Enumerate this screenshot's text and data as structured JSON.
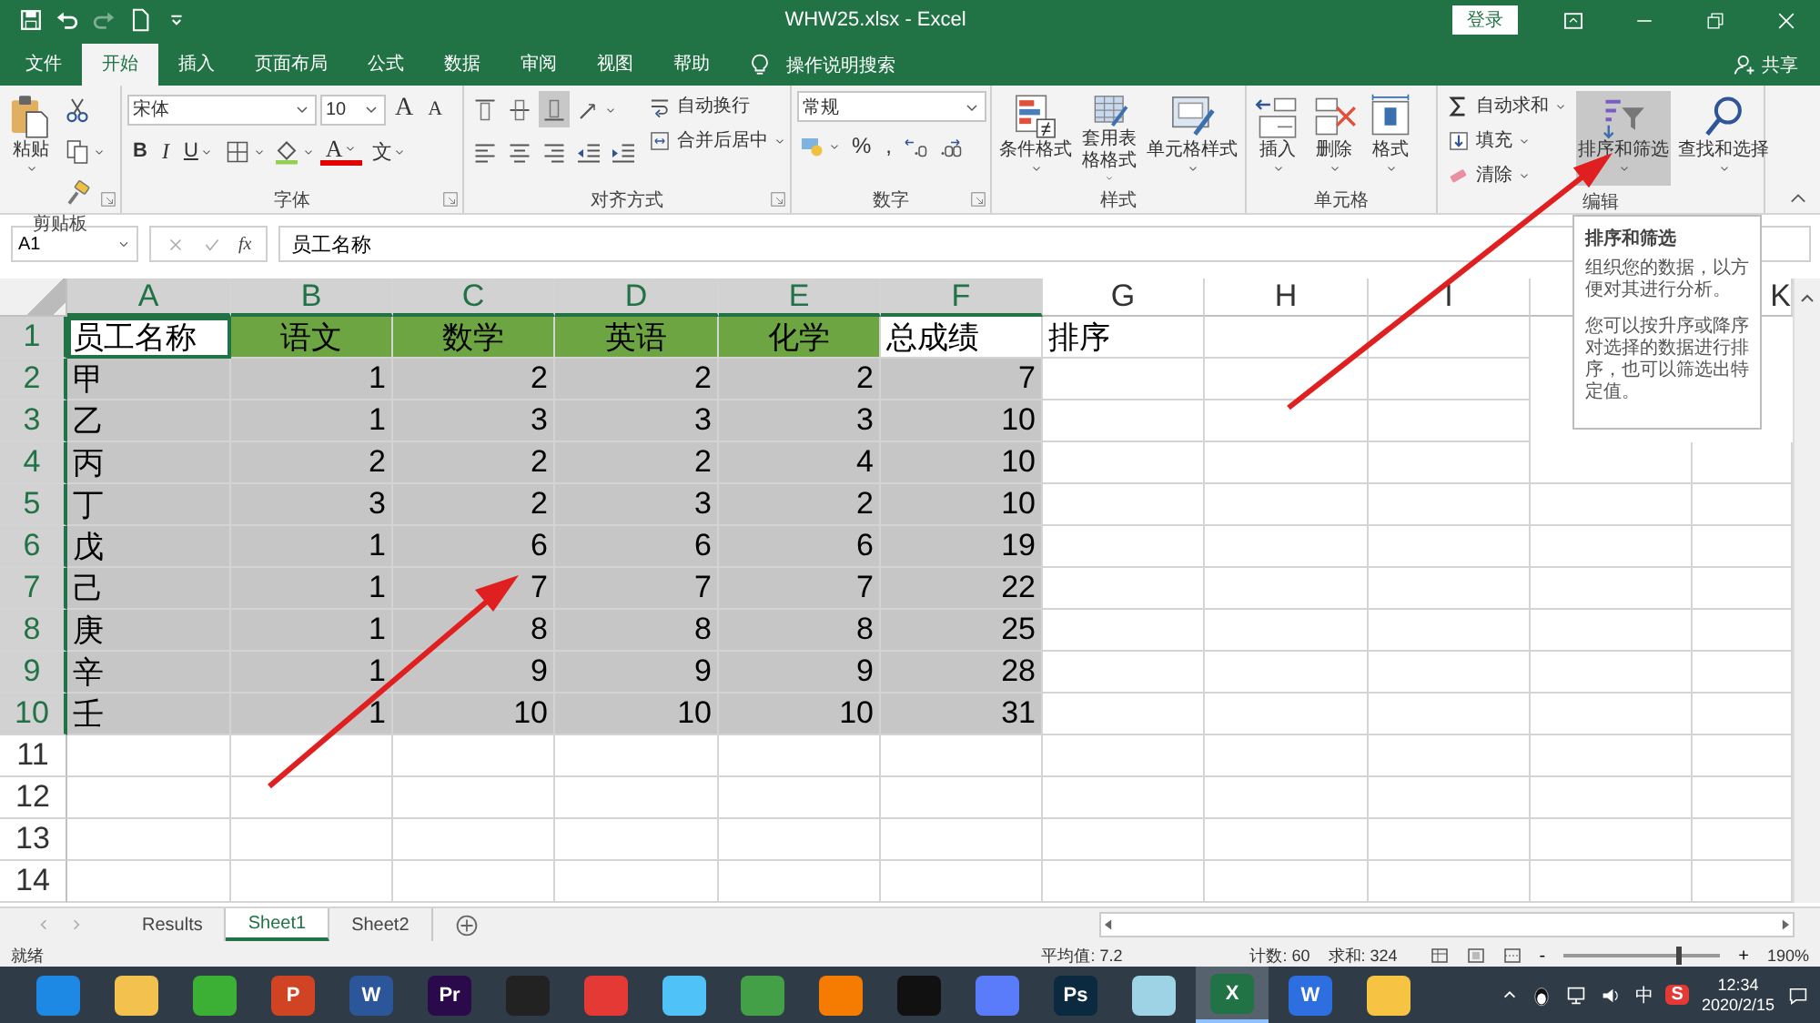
{
  "title_bar": {
    "title": "WHW25.xlsx  -  Excel",
    "login": "登录"
  },
  "tabs": [
    {
      "label": "文件",
      "selected": false
    },
    {
      "label": "开始",
      "selected": true
    },
    {
      "label": "插入",
      "selected": false
    },
    {
      "label": "页面布局",
      "selected": false
    },
    {
      "label": "公式",
      "selected": false
    },
    {
      "label": "数据",
      "selected": false
    },
    {
      "label": "审阅",
      "selected": false
    },
    {
      "label": "视图",
      "selected": false
    },
    {
      "label": "帮助",
      "selected": false
    }
  ],
  "tell_me": "操作说明搜索",
  "share": "共享",
  "ribbon": [
    {
      "kind": "clipboard",
      "label": "剪贴板",
      "items": [
        {
          "kind": "paste",
          "label": "粘贴"
        },
        {
          "kind": "cut"
        },
        {
          "kind": "copy"
        },
        {
          "kind": "painter"
        }
      ]
    },
    {
      "kind": "font",
      "label": "字体",
      "items": [
        {
          "kind": "font-name",
          "value": "宋体"
        },
        {
          "kind": "font-size",
          "value": "10"
        },
        {
          "kind": "grow",
          "label": "A"
        },
        {
          "kind": "shrink",
          "label": "A"
        },
        {
          "kind": "bold",
          "label": "B"
        },
        {
          "kind": "italic",
          "label": "I"
        },
        {
          "kind": "underline",
          "label": "U"
        },
        {
          "kind": "border"
        },
        {
          "kind": "fill-color"
        },
        {
          "kind": "font-color",
          "label": "A"
        },
        {
          "kind": "phonetic",
          "label": "文"
        }
      ]
    },
    {
      "kind": "alignment",
      "label": "对齐方式",
      "items": [
        {
          "kind": "align-top",
          "selected": false
        },
        {
          "kind": "align-middle",
          "selected": false
        },
        {
          "kind": "align-bottom",
          "selected": true
        },
        {
          "kind": "orientation"
        },
        {
          "kind": "align-left"
        },
        {
          "kind": "align-center"
        },
        {
          "kind": "align-right"
        },
        {
          "kind": "indent-less"
        },
        {
          "kind": "indent-more"
        },
        {
          "kind": "wrap",
          "label": "自动换行"
        },
        {
          "kind": "merge",
          "label": "合并后居中"
        }
      ]
    },
    {
      "kind": "number",
      "label": "数字",
      "items": [
        {
          "kind": "number-format",
          "value": "常规"
        },
        {
          "kind": "currency"
        },
        {
          "kind": "percent",
          "label": "%"
        },
        {
          "kind": "comma",
          "label": ","
        },
        {
          "kind": "inc-decimal"
        },
        {
          "kind": "dec-decimal"
        }
      ]
    },
    {
      "kind": "styles",
      "label": "样式",
      "items": [
        {
          "kind": "cond-format",
          "label": "条件格式"
        },
        {
          "kind": "table-format",
          "label": "套用表格格式"
        },
        {
          "kind": "cell-style",
          "label": "单元格样式"
        }
      ]
    },
    {
      "kind": "cells",
      "label": "单元格",
      "items": [
        {
          "kind": "insert-cells",
          "label": "插入"
        },
        {
          "kind": "delete-cells",
          "label": "删除"
        },
        {
          "kind": "format-cells",
          "label": "格式"
        }
      ]
    },
    {
      "kind": "editing",
      "label": "编辑",
      "items": [
        {
          "kind": "sum",
          "label": "自动求和"
        },
        {
          "kind": "fill-down",
          "label": "填充"
        },
        {
          "kind": "eraser",
          "label": "清除"
        },
        {
          "kind": "sort-filter",
          "label": "排序和筛选",
          "selected": true
        },
        {
          "kind": "find",
          "label": "查找和选择",
          "selected": false
        }
      ]
    }
  ],
  "formula_bar": {
    "name_box": "A1",
    "function_label": "fx",
    "value": "员工名称"
  },
  "columns": [
    {
      "label": "A",
      "selected": true
    },
    {
      "label": "B",
      "selected": true
    },
    {
      "label": "C",
      "selected": true
    },
    {
      "label": "D",
      "selected": true
    },
    {
      "label": "E",
      "selected": true
    },
    {
      "label": "F",
      "selected": true
    },
    {
      "label": "G",
      "selected": false
    },
    {
      "label": "H",
      "selected": false
    },
    {
      "label": "I",
      "selected": false
    },
    {
      "selected": false
    },
    {
      "label": "K",
      "selected": false
    }
  ],
  "rows": [
    {
      "number": "1",
      "selected": true,
      "cells": [
        {
          "text": "员工名称",
          "kind": "active",
          "numeric": false
        },
        {
          "text": "语文",
          "kind": "green",
          "numeric": false
        },
        {
          "text": "数学",
          "kind": "green",
          "numeric": false
        },
        {
          "text": "英语",
          "kind": "green",
          "numeric": false
        },
        {
          "text": "化学",
          "kind": "green",
          "numeric": false
        },
        {
          "text": "总成绩",
          "kind": "plain",
          "numeric": false
        },
        {
          "text": "排序",
          "kind": "plain",
          "numeric": false
        }
      ]
    },
    {
      "number": "2",
      "selected": true,
      "cells": [
        {
          "text": "甲",
          "kind": "selected",
          "numeric": false
        },
        {
          "text": "1",
          "kind": "selected",
          "numeric": true
        },
        {
          "text": "2",
          "kind": "selected",
          "numeric": true
        },
        {
          "text": "2",
          "kind": "selected",
          "numeric": true
        },
        {
          "text": "2",
          "kind": "selected",
          "numeric": true
        },
        {
          "text": "7",
          "kind": "selected",
          "numeric": true
        }
      ]
    },
    {
      "number": "3",
      "selected": true,
      "cells": [
        {
          "text": "乙",
          "kind": "selected",
          "numeric": false
        },
        {
          "text": "1",
          "kind": "selected",
          "numeric": true
        },
        {
          "text": "3",
          "kind": "selected",
          "numeric": true
        },
        {
          "text": "3",
          "kind": "selected",
          "numeric": true
        },
        {
          "text": "3",
          "kind": "selected",
          "numeric": true
        },
        {
          "text": "10",
          "kind": "selected",
          "numeric": true
        }
      ]
    },
    {
      "number": "4",
      "selected": true,
      "cells": [
        {
          "text": "丙",
          "kind": "selected",
          "numeric": false
        },
        {
          "text": "2",
          "kind": "selected",
          "numeric": true
        },
        {
          "text": "2",
          "kind": "selected",
          "numeric": true
        },
        {
          "text": "2",
          "kind": "selected",
          "numeric": true
        },
        {
          "text": "4",
          "kind": "selected",
          "numeric": true
        },
        {
          "text": "10",
          "kind": "selected",
          "numeric": true
        }
      ]
    },
    {
      "number": "5",
      "selected": true,
      "cells": [
        {
          "text": "丁",
          "kind": "selected",
          "numeric": false
        },
        {
          "text": "3",
          "kind": "selected",
          "numeric": true
        },
        {
          "text": "2",
          "kind": "selected",
          "numeric": true
        },
        {
          "text": "3",
          "kind": "selected",
          "numeric": true
        },
        {
          "text": "2",
          "kind": "selected",
          "numeric": true
        },
        {
          "text": "10",
          "kind": "selected",
          "numeric": true
        }
      ]
    },
    {
      "number": "6",
      "selected": true,
      "cells": [
        {
          "text": "戊",
          "kind": "selected",
          "numeric": false
        },
        {
          "text": "1",
          "kind": "selected",
          "numeric": true
        },
        {
          "text": "6",
          "kind": "selected",
          "numeric": true
        },
        {
          "text": "6",
          "kind": "selected",
          "numeric": true
        },
        {
          "text": "6",
          "kind": "selected",
          "numeric": true
        },
        {
          "text": "19",
          "kind": "selected",
          "numeric": true
        }
      ]
    },
    {
      "number": "7",
      "selected": true,
      "cells": [
        {
          "text": "己",
          "kind": "selected",
          "numeric": false
        },
        {
          "text": "1",
          "kind": "selected",
          "numeric": true
        },
        {
          "text": "7",
          "kind": "selected",
          "numeric": true
        },
        {
          "text": "7",
          "kind": "selected",
          "numeric": true
        },
        {
          "text": "7",
          "kind": "selected",
          "numeric": true
        },
        {
          "text": "22",
          "kind": "selected",
          "numeric": true
        }
      ]
    },
    {
      "number": "8",
      "selected": true,
      "cells": [
        {
          "text": "庚",
          "kind": "selected",
          "numeric": false
        },
        {
          "text": "1",
          "kind": "selected",
          "numeric": true
        },
        {
          "text": "8",
          "kind": "selected",
          "numeric": true
        },
        {
          "text": "8",
          "kind": "selected",
          "numeric": true
        },
        {
          "text": "8",
          "kind": "selected",
          "numeric": true
        },
        {
          "text": "25",
          "kind": "selected",
          "numeric": true
        }
      ]
    },
    {
      "number": "9",
      "selected": true,
      "cells": [
        {
          "text": "辛",
          "kind": "selected",
          "numeric": false
        },
        {
          "text": "1",
          "kind": "selected",
          "numeric": true
        },
        {
          "text": "9",
          "kind": "selected",
          "numeric": true
        },
        {
          "text": "9",
          "kind": "selected",
          "numeric": true
        },
        {
          "text": "9",
          "kind": "selected",
          "numeric": true
        },
        {
          "text": "28",
          "kind": "selected",
          "numeric": true
        }
      ]
    },
    {
      "number": "10",
      "selected": true,
      "cells": [
        {
          "text": "壬",
          "kind": "selected",
          "numeric": false
        },
        {
          "text": "1",
          "kind": "selected",
          "numeric": true
        },
        {
          "text": "10",
          "kind": "selected",
          "numeric": true
        },
        {
          "text": "10",
          "kind": "selected",
          "numeric": true
        },
        {
          "text": "10",
          "kind": "selected",
          "numeric": true
        },
        {
          "text": "31",
          "kind": "selected",
          "numeric": true
        }
      ]
    },
    {
      "number": "11",
      "selected": false,
      "cells": []
    },
    {
      "number": "12",
      "selected": false,
      "cells": []
    },
    {
      "number": "13",
      "selected": false,
      "cells": []
    },
    {
      "number": "14",
      "selected": false,
      "cells": []
    }
  ],
  "tooltip": {
    "title": "排序和筛选",
    "paragraphs": [
      "组织您的数据，以方便对其进行分析。",
      "您可以按升序或降序对选择的数据进行排序，也可以筛选出特定值。"
    ]
  },
  "sheet_tabs": [
    {
      "label": "Results",
      "selected": false
    },
    {
      "label": "Sheet1",
      "selected": true
    },
    {
      "label": "Sheet2",
      "selected": false
    }
  ],
  "status_bar": {
    "state": "就绪",
    "average": "平均值: 7.2",
    "count": "计数: 60",
    "sum": "求和: 324",
    "minus": "-",
    "plus": "+",
    "zoom": "190%",
    "zoom_slider": {
      "level": 0.72
    }
  },
  "taskbar": {
    "apps": [
      {
        "color": "#1e88e5",
        "selected": false
      },
      {
        "color": "#f2c14e",
        "selected": false
      },
      {
        "color": "#3cb034",
        "selected": false
      },
      {
        "label": "P",
        "color": "#d04423",
        "selected": false
      },
      {
        "label": "W",
        "color": "#2b579a",
        "selected": false
      },
      {
        "label": "Pr",
        "color": "#2a0a4a",
        "selected": false
      },
      {
        "color": "#222222",
        "selected": false
      },
      {
        "color": "#e53935",
        "selected": false
      },
      {
        "color": "#4fc3f7",
        "selected": false
      },
      {
        "color": "#43a047",
        "selected": false
      },
      {
        "color": "#f57c00",
        "selected": false
      },
      {
        "color": "#111111",
        "selected": false
      },
      {
        "color": "#5b7cfa",
        "selected": false
      },
      {
        "label": "Ps",
        "color": "#0b2a3f",
        "selected": false
      },
      {
        "color": "#9ed3e6",
        "selected": false
      },
      {
        "label": "X",
        "color": "#217346",
        "selected": true
      },
      {
        "label": "W",
        "color": "#2d6fe0",
        "selected": false
      },
      {
        "color": "#f6c343",
        "selected": false
      }
    ],
    "input_method": "中",
    "ime_label": "S",
    "time": "12:34",
    "date": "2020/2/15"
  }
}
